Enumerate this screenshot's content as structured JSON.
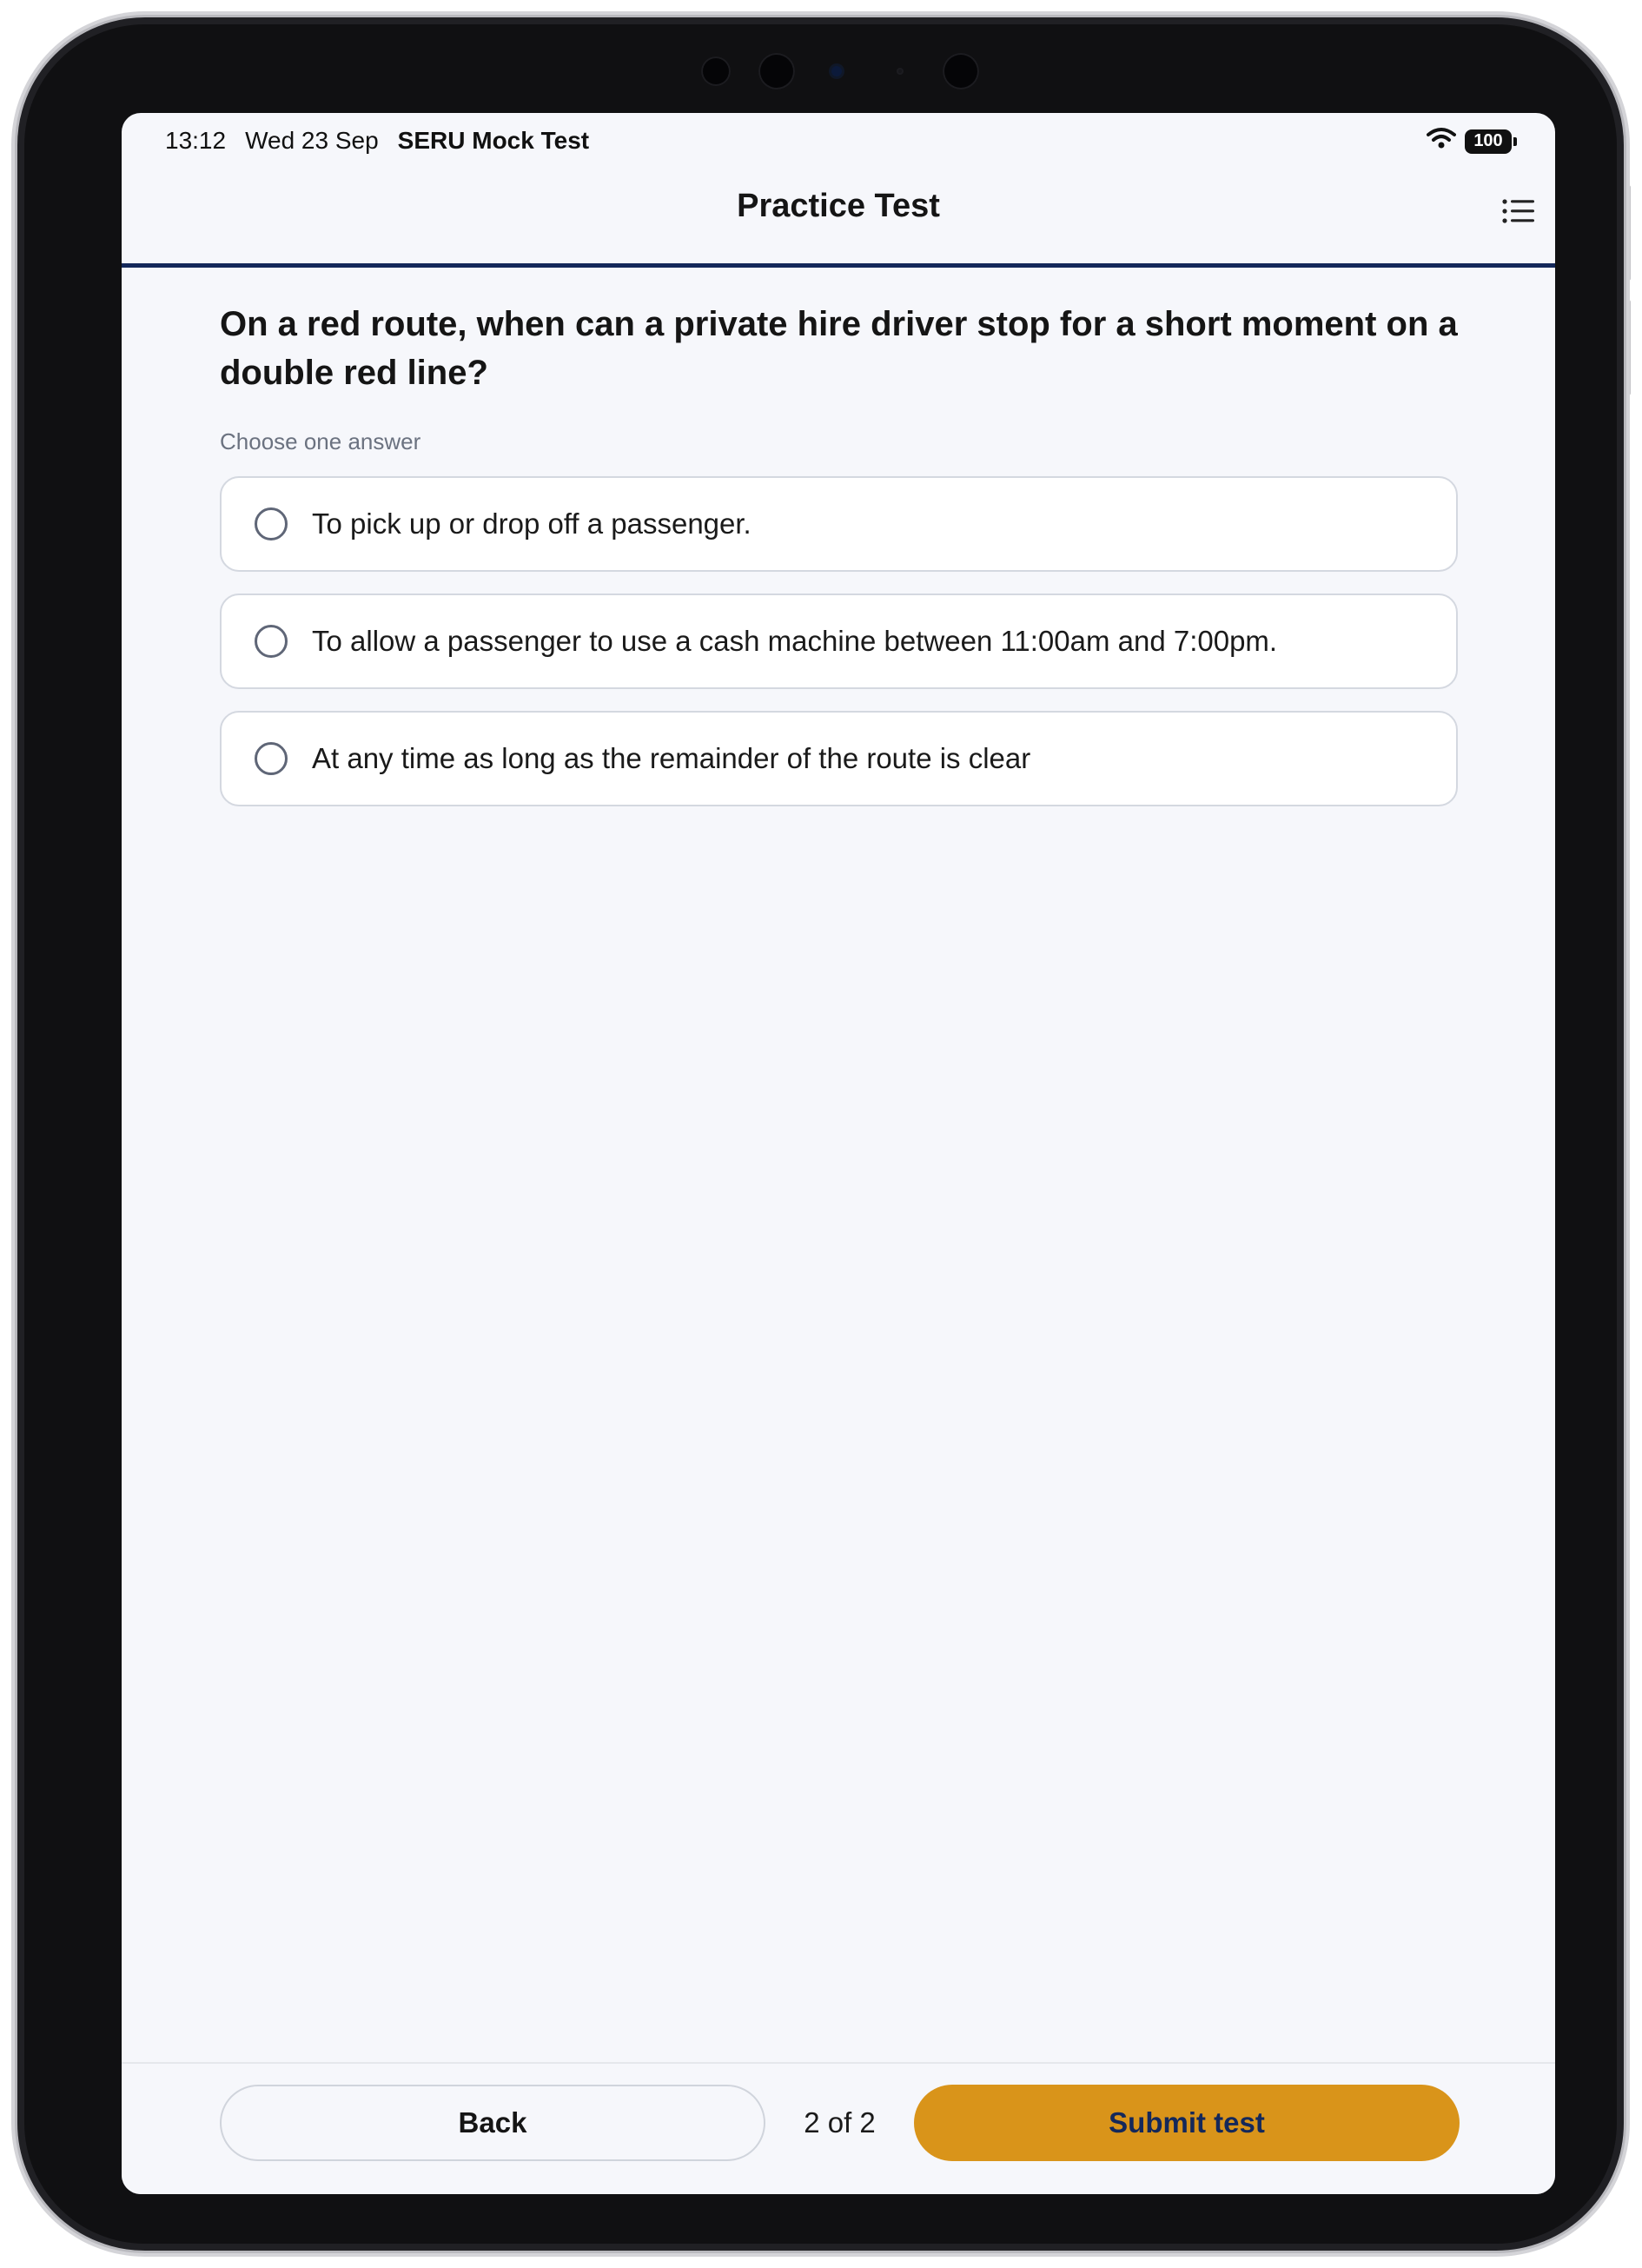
{
  "status_bar": {
    "time": "13:12",
    "date": "Wed 23 Sep",
    "app_name": "SERU Mock Test",
    "battery": "100"
  },
  "header": {
    "title": "Practice Test",
    "menu_icon": "list-icon"
  },
  "question": {
    "text": "On a red route, when can a private hire driver stop for a short moment on a double red line?",
    "instruction": "Choose one answer",
    "options": [
      {
        "label": "To pick up or drop off a passenger."
      },
      {
        "label": "To allow a passenger to use a cash machine between 11:00am and 7:00pm."
      },
      {
        "label": "At any time as long as the remainder of the route is clear"
      }
    ]
  },
  "footer": {
    "back_label": "Back",
    "progress": "2 of 2",
    "submit_label": "Submit test"
  },
  "colors": {
    "accent": "#d9941a",
    "navy": "#14285a",
    "background": "#f6f7fb"
  }
}
